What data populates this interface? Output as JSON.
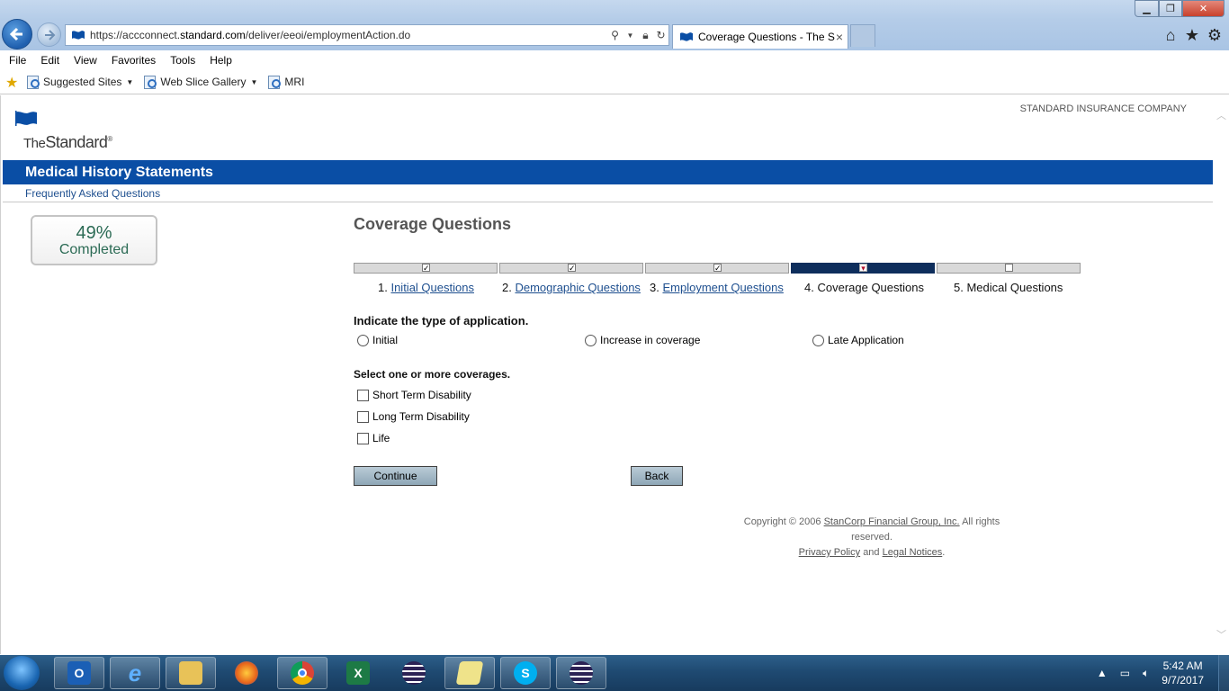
{
  "browser": {
    "url_prefix": "https://accconnect.",
    "url_domain": "standard.com",
    "url_path": "/deliver/eeoi/employmentAction.do",
    "tab_title": "Coverage Questions - The S...",
    "tab_close": "×",
    "icons": {
      "back": "back-arrow-icon",
      "forward": "forward-arrow-icon",
      "search": "search-icon",
      "lock": "lock-icon",
      "refresh": "refresh-icon",
      "home": "home-icon",
      "favorites": "star-icon",
      "tools": "gear-icon"
    },
    "window": {
      "minimize": "▁",
      "maximize": "❐",
      "close": "✕"
    }
  },
  "menu": [
    "File",
    "Edit",
    "View",
    "Favorites",
    "Tools",
    "Help"
  ],
  "favorites_bar": {
    "items": [
      {
        "label": "Suggested Sites",
        "dropdown": true
      },
      {
        "label": "Web Slice Gallery",
        "dropdown": true
      },
      {
        "label": "MRI",
        "dropdown": false
      }
    ]
  },
  "page": {
    "company": "STANDARD INSURANCE COMPANY",
    "logo": {
      "the": "The",
      "name": "Standard",
      "reg": "®"
    },
    "banner_title": "Medical History Statements",
    "faq_link": "Frequently Asked Questions",
    "progress": {
      "percent": "49%",
      "label": "Completed",
      "value": 49
    },
    "title": "Coverage Questions",
    "steps": [
      {
        "num": "1.",
        "label": "Initial Questions",
        "link": true,
        "status": "done"
      },
      {
        "num": "2.",
        "label": "Demographic Questions",
        "link": true,
        "status": "done"
      },
      {
        "num": "3.",
        "label": "Employment Questions",
        "link": true,
        "status": "done"
      },
      {
        "num": "4.",
        "label": "Coverage Questions",
        "link": false,
        "status": "current"
      },
      {
        "num": "5.",
        "label": "Medical Questions",
        "link": false,
        "status": "todo"
      }
    ],
    "application_type": {
      "question": "Indicate the type of application.",
      "options": [
        "Initial",
        "Increase in coverage",
        "Late Application"
      ]
    },
    "coverages": {
      "question": "Select one or more coverages.",
      "options": [
        "Short Term Disability",
        "Long Term Disability",
        "Life"
      ]
    },
    "buttons": {
      "continue": "Continue",
      "back": "Back"
    },
    "footer": {
      "copyright": "Copyright © 2006",
      "company_link": "StanCorp Financial Group, Inc.",
      "rights": "All rights reserved.",
      "privacy": "Privacy Policy",
      "and": "and",
      "legal": "Legal Notices",
      "period": "."
    }
  },
  "taskbar": {
    "apps": [
      "outlook-icon",
      "internet-explorer-icon",
      "file-explorer-icon",
      "firefox-icon",
      "chrome-icon",
      "excel-icon",
      "eclipse-icon",
      "notes-icon",
      "skype-icon",
      "eclipse-icon"
    ],
    "time": "5:42 AM",
    "date": "9/7/2017"
  },
  "colors": {
    "brand_blue": "#0a4ea5",
    "step_active": "#0e2e5c",
    "link": "#1e4f8f",
    "progress_text": "#2c6b55"
  }
}
